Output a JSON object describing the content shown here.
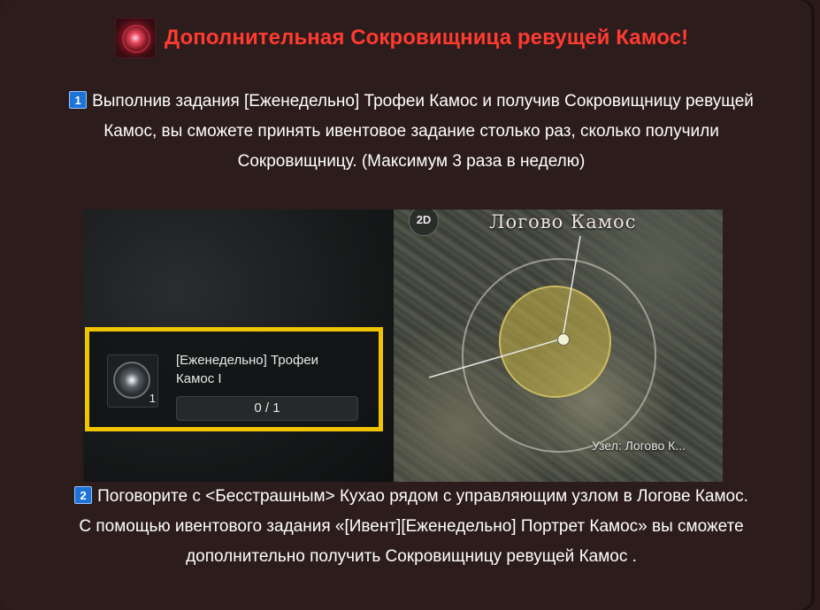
{
  "header": {
    "icon": "kamos-treasure-icon",
    "title": "Дополнительная Сокровищница ревущей Камос!"
  },
  "step1": {
    "number": "1",
    "line1": "Выполнив задания [Еженедельно] Трофеи Камос и получив Сокровищницу ревущей",
    "line2": "Камос, вы сможете принять ивентовое задание столько раз, сколько получили",
    "line3": "Сокровищницу. (Максимум 3 раза в неделю)"
  },
  "screenshot": {
    "quest": {
      "icon": "kamos-trophy-icon",
      "count": "1",
      "name_line1": "[Еженедельно] Трофеи",
      "name_line2": "Камос I",
      "progress": "0 / 1"
    },
    "map": {
      "title": "Логово Камос",
      "mode_button": "2D",
      "node_label": "Узел: Логово К..."
    }
  },
  "step2": {
    "number": "2",
    "line1": "Поговорите с <Бесстрашным> Кухао рядом с управляющим узлом в Логове Камос.",
    "line2": "С помощью ивентового задания «[Ивент][Еженедельно] Портрет Камос» вы сможете",
    "line3": "дополнительно получить Сокровищницу ревущей Камос ."
  },
  "colors": {
    "background": "#2d1c1c",
    "title": "#ff3b30",
    "number_badge": "#1e73d6",
    "highlight_frame": "#f0c400"
  }
}
